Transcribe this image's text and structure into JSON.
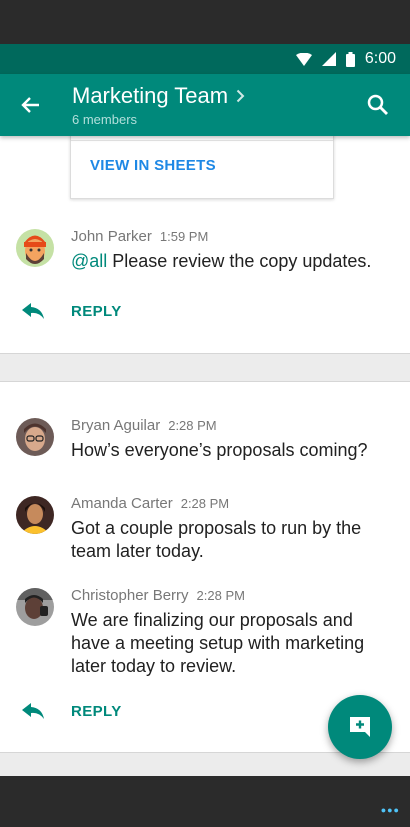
{
  "status_bar": {
    "time": "6:00"
  },
  "header": {
    "title": "Marketing Team",
    "subtitle": "6 members"
  },
  "attachment_card": {
    "action_label": "VIEW IN SHEETS"
  },
  "thread1": {
    "messages": [
      {
        "sender": "John Parker",
        "time": "1:59 PM",
        "mention": "@all",
        "text": " Please review the copy updates."
      }
    ],
    "reply_label": "REPLY"
  },
  "thread2": {
    "messages": [
      {
        "sender": "Bryan Aguilar",
        "time": "2:28 PM",
        "text": "How’s everyone’s proposals coming?"
      },
      {
        "sender": "Amanda Carter",
        "time": "2:28 PM",
        "text": "Got a couple proposals to run by the team later today."
      },
      {
        "sender": "Christopher Berry",
        "time": "2:28 PM",
        "text": "We are finalizing our proposals and have a meeting setup with marketing later today to review."
      }
    ],
    "reply_label": "REPLY"
  },
  "icons": {
    "back": "arrow-back-icon",
    "chevron": "chevron-right-icon",
    "search": "search-icon",
    "reply": "reply-icon",
    "fab": "add-comment-icon",
    "wifi": "wifi-icon",
    "signal": "signal-icon",
    "battery": "battery-icon"
  },
  "colors": {
    "status_bar": "#00695c",
    "app_bar": "#00897b",
    "accent": "#00897b",
    "link_blue": "#1e88e5"
  }
}
